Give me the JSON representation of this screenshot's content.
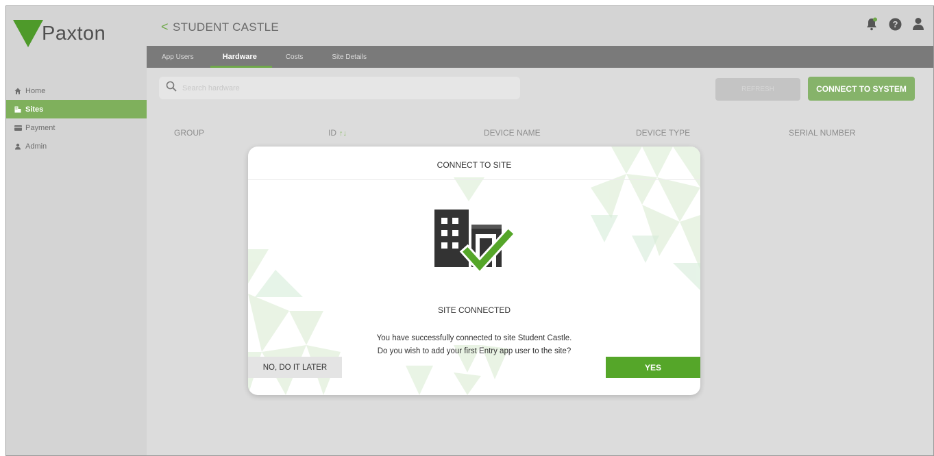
{
  "brand": {
    "name": "Paxton",
    "color": "#4e9a2a"
  },
  "sidebar": {
    "items": [
      {
        "label": "Home",
        "icon": "home-icon",
        "active": false
      },
      {
        "label": "Sites",
        "icon": "building-icon",
        "active": true
      },
      {
        "label": "Payment",
        "icon": "card-icon",
        "active": false
      },
      {
        "label": "Admin",
        "icon": "user-icon",
        "active": false
      }
    ]
  },
  "header": {
    "back_glyph": "<",
    "title": "STUDENT CASTLE",
    "icons": [
      "notification-bell-icon",
      "help-icon",
      "account-icon"
    ]
  },
  "tabs": [
    {
      "label": "App Users",
      "active": false
    },
    {
      "label": "Hardware",
      "active": true
    },
    {
      "label": "Costs",
      "active": false
    },
    {
      "label": "Site Details",
      "active": false
    }
  ],
  "toolbar": {
    "search_placeholder": "Search hardware",
    "refresh_label": "REFRESH",
    "connect_label": "CONNECT TO SYSTEM"
  },
  "table": {
    "columns": [
      "GROUP",
      "ID",
      "DEVICE NAME",
      "DEVICE TYPE",
      "SERIAL NUMBER"
    ],
    "sort_glyph": "↑↓",
    "rows": []
  },
  "modal": {
    "title": "CONNECT TO SITE",
    "illustration": "building-check-icon",
    "heading": "SITE CONNECTED",
    "message_line1": "You have successfully connected to site Student Castle.",
    "message_line2": "Do you wish to add your first Entry app user to the site?",
    "no_label": "NO, DO IT LATER",
    "yes_label": "YES"
  },
  "colors": {
    "accent_green": "#55a629",
    "muted_green": "#86b36a",
    "sidebar_bg": "#d4d4d4",
    "tab_bar_bg": "#7a7a7a"
  }
}
